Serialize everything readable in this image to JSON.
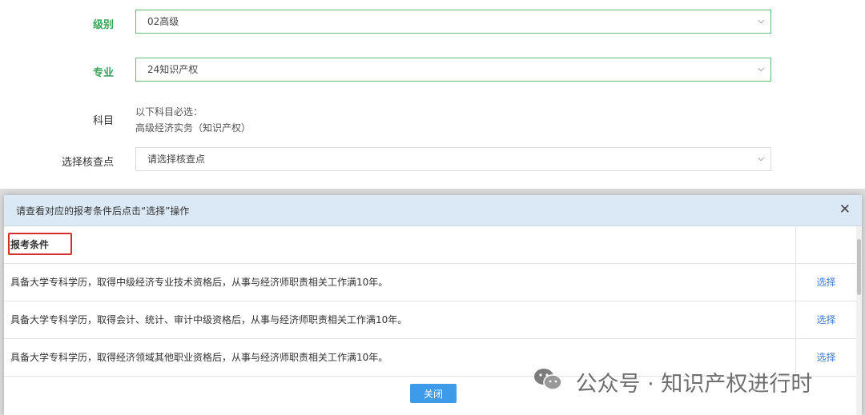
{
  "form": {
    "level_label": "级别",
    "level_value": "02高级",
    "major_label": "专业",
    "major_value": "24知识产权",
    "subject_label": "科目",
    "subject_note": "以下科目必选：",
    "subject_value": "高级经济实务（知识产权）",
    "site_label": "选择核查点",
    "site_placeholder": "请选择核查点"
  },
  "modal": {
    "title": "请查看对应的报考条件后点击“选择”操作",
    "close_icon": "close-icon",
    "table_header": "报考条件",
    "rows": [
      {
        "text": "具备大学专科学历，取得中级经济专业技术资格后，从事与经济师职责相关工作满10年。",
        "action": "选择"
      },
      {
        "text": "具备大学专科学历，取得会计、统计、审计中级资格后，从事与经济师职责相关工作满10年。",
        "action": "选择"
      },
      {
        "text": "具备大学专科学历，取得经济领域其他职业资格后，从事与经济师职责相关工作满10年。",
        "action": "选择"
      }
    ],
    "close_button": "关闭"
  },
  "watermark": {
    "text": "公众号 · 知识产权进行时",
    "icon": "wechat-icon"
  },
  "colors": {
    "accent_green": "#3aa35a",
    "link_blue": "#3a7bd5",
    "button_blue": "#3d9bea",
    "highlight_red": "#d82b2b",
    "modal_header": "#dbe8f5"
  }
}
